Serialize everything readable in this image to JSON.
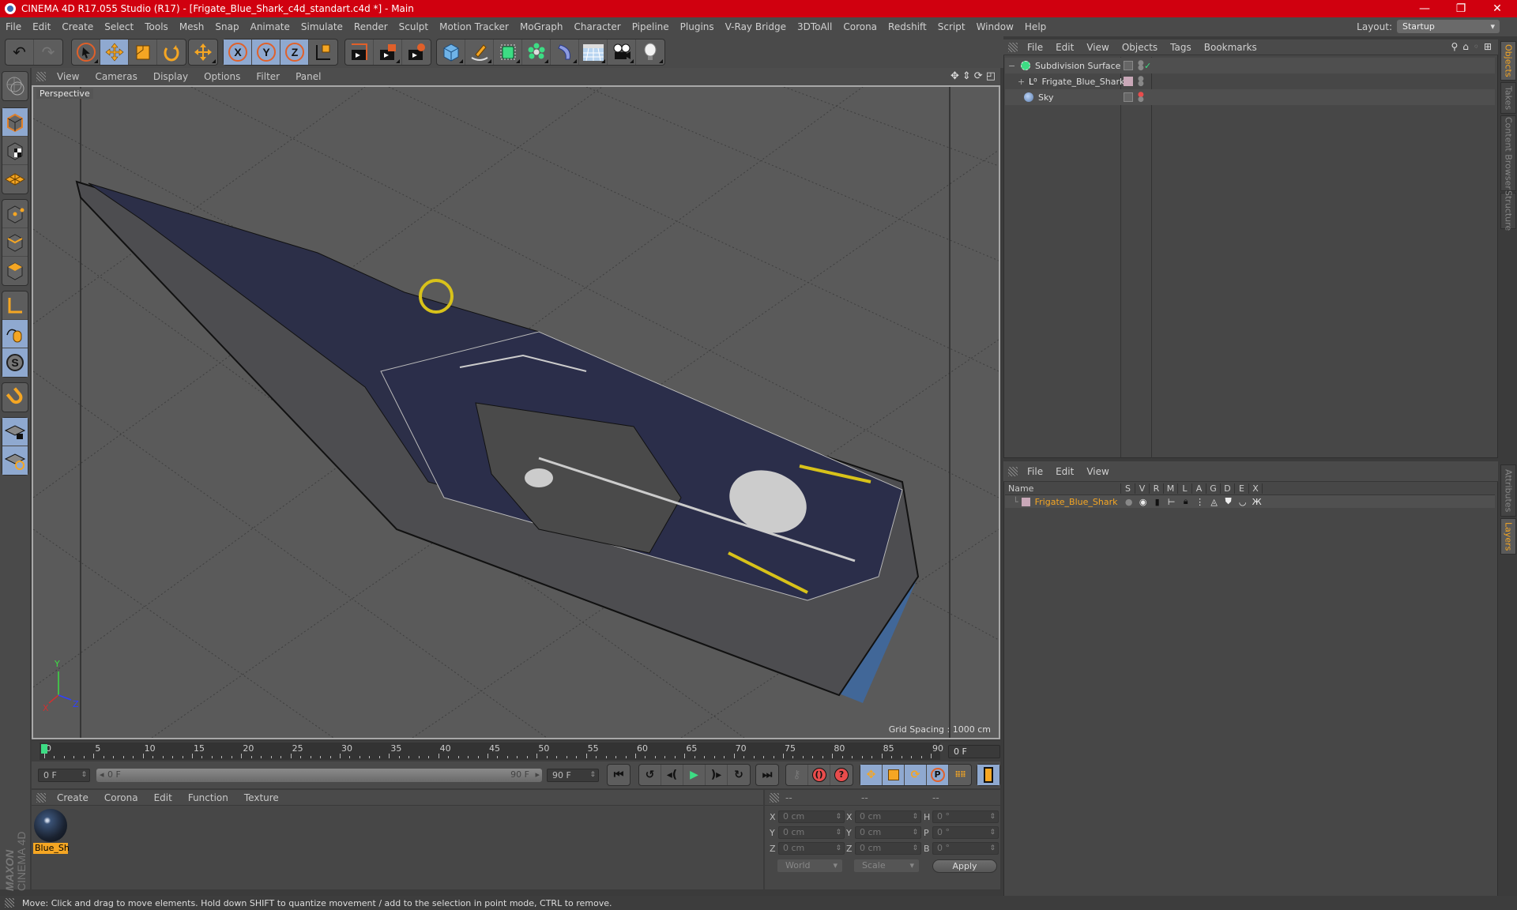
{
  "window": {
    "title": "CINEMA 4D R17.055 Studio (R17) - [Frigate_Blue_Shark_c4d_standart.c4d *] - Main",
    "controls": [
      "minimize",
      "restore",
      "close"
    ]
  },
  "menubar": {
    "items": [
      "File",
      "Edit",
      "Create",
      "Select",
      "Tools",
      "Mesh",
      "Snap",
      "Animate",
      "Simulate",
      "Render",
      "Sculpt",
      "Motion Tracker",
      "MoGraph",
      "Character",
      "Pipeline",
      "Plugins",
      "V-Ray Bridge",
      "3DToAll",
      "Corona",
      "Redshift",
      "Script",
      "Window",
      "Help"
    ],
    "layout_label": "Layout:",
    "layout_value": "Startup"
  },
  "toolbar": {
    "groups": [
      [
        "undo-icon",
        "redo-icon"
      ],
      [
        "live-selection-icon",
        "move-icon",
        "scale-icon",
        "rotate-icon"
      ],
      [
        "last-tool-icon"
      ],
      [
        "x-axis-lock-icon",
        "y-axis-lock-icon",
        "z-axis-lock-icon",
        "coordinate-system-icon"
      ],
      [
        "render-view-icon",
        "render-picture-viewer-icon",
        "render-settings-icon"
      ],
      [
        "cube-icon",
        "pen-spline-icon",
        "subdivision-surface-icon",
        "mograph-cloner-icon",
        "deformer-icon",
        "floor-icon",
        "camera-icon",
        "light-icon"
      ]
    ],
    "active": [
      "move-icon",
      "x-axis-lock-icon",
      "y-axis-lock-icon",
      "z-axis-lock-icon"
    ]
  },
  "left_tools": {
    "items": [
      "make-editable-icon",
      "model-mode-icon",
      "texture-mode-icon",
      "workplane-mode-icon",
      "points-mode-icon",
      "edges-mode-icon",
      "polygons-mode-icon",
      "axis-mode-icon",
      "tweak-mode-icon",
      "snap-icon",
      "magnet-icon",
      "lock-workplane-icon",
      "solo-icon"
    ],
    "active": [
      "model-mode-icon",
      "tweak-mode-icon",
      "snap-icon",
      "lock-workplane-icon",
      "solo-icon"
    ]
  },
  "viewport": {
    "menu": [
      "View",
      "Cameras",
      "Display",
      "Options",
      "Filter",
      "Panel"
    ],
    "label": "Perspective",
    "grid_spacing": "Grid Spacing : 1000 cm",
    "axis_labels": {
      "x": "X",
      "y": "Y",
      "z": "Z"
    }
  },
  "timeline": {
    "ticks": [
      "0",
      "5",
      "10",
      "15",
      "20",
      "25",
      "30",
      "35",
      "40",
      "45",
      "50",
      "55",
      "60",
      "65",
      "70",
      "75",
      "80",
      "85",
      "90"
    ],
    "current_frame": "0 F",
    "start_field": "0 F",
    "range_start": "0 F",
    "range_end": "90 F",
    "end_field": "90 F",
    "playhead_color": "#3ddc84"
  },
  "transport": {
    "buttons": [
      "go-to-start-icon",
      "previous-key-icon",
      "previous-frame-icon",
      "play-icon",
      "next-frame-icon",
      "next-key-icon",
      "go-to-end-icon"
    ],
    "record_buttons": [
      "record-disabled-icon",
      "autokey-icon",
      "keyframe-selection-icon"
    ],
    "key_buttons": [
      "key-position-icon",
      "key-scale-icon",
      "key-rotation-icon",
      "key-parameter-icon",
      "key-pla-icon"
    ],
    "timeline_button": "timeline-window-icon"
  },
  "materials": {
    "menu": [
      "Create",
      "Corona",
      "Edit",
      "Function",
      "Texture"
    ],
    "items": [
      {
        "label": "Blue_Sh"
      }
    ]
  },
  "coordinates": {
    "headers": [
      "--",
      "--",
      "--"
    ],
    "rows": [
      {
        "l1": "X",
        "v1": "0 cm",
        "l2": "X",
        "v2": "0 cm",
        "l3": "H",
        "v3": "0 °"
      },
      {
        "l1": "Y",
        "v1": "0 cm",
        "l2": "Y",
        "v2": "0 cm",
        "l3": "P",
        "v3": "0 °"
      },
      {
        "l1": "Z",
        "v1": "0 cm",
        "l2": "Z",
        "v2": "0 cm",
        "l3": "B",
        "v3": "0 °"
      }
    ],
    "space": "World",
    "mode": "Scale",
    "apply": "Apply"
  },
  "objects": {
    "menu": [
      "File",
      "Edit",
      "View",
      "Objects",
      "Tags",
      "Bookmarks"
    ],
    "tree": [
      {
        "name": "Subdivision Surface",
        "expander": "−",
        "icon": "subdivision-surface-icon"
      },
      {
        "name": "Frigate_Blue_Shark",
        "expander": "+",
        "icon": "null-object-icon"
      },
      {
        "name": "Sky",
        "expander": "",
        "icon": "sky-icon"
      }
    ]
  },
  "layers": {
    "menu": [
      "File",
      "Edit",
      "View"
    ],
    "columns": [
      "Name",
      "S",
      "V",
      "R",
      "M",
      "L",
      "A",
      "G",
      "D",
      "E",
      "X"
    ],
    "rows": [
      {
        "name": "Frigate_Blue_Shark",
        "color": "#c9a8b8"
      }
    ]
  },
  "side_tabs": {
    "top": [
      "Objects",
      "Takes",
      "Content Browser",
      "Structure"
    ],
    "bottom": [
      "Attributes",
      "Layers"
    ],
    "active": [
      "Objects",
      "Layers"
    ]
  },
  "branding": {
    "line1": "MAXON",
    "line2": "CINEMA 4D"
  },
  "status": "Move: Click and drag to move elements. Hold down SHIFT to quantize movement / add to the selection in point mode, CTRL to remove.",
  "colors": {
    "accent": "#f5a623",
    "titlebar": "#d0000f",
    "active_button": "#8fa9d0"
  }
}
